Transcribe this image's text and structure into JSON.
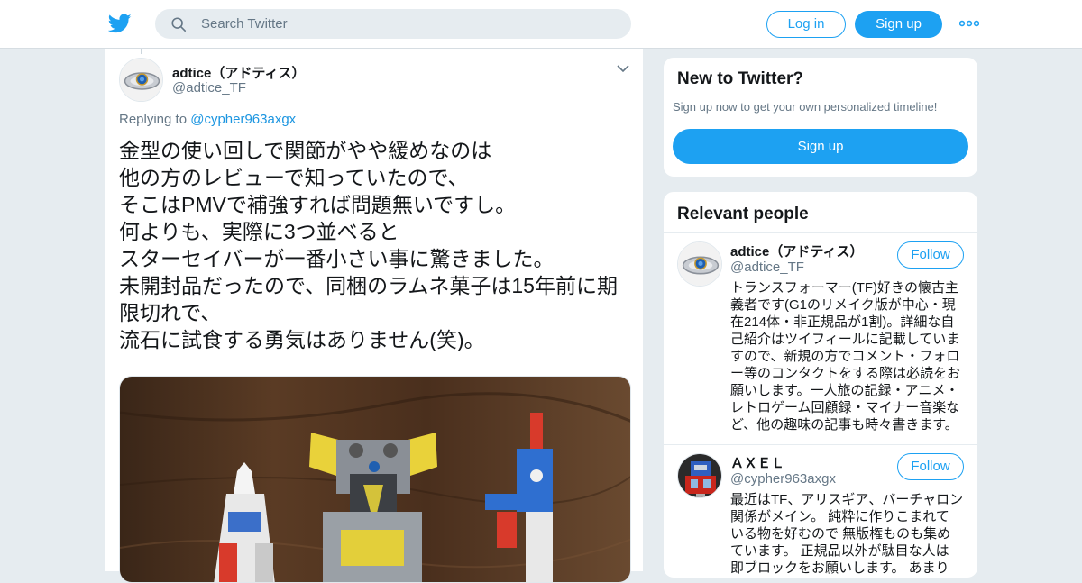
{
  "header": {
    "search_placeholder": "Search Twitter",
    "login_label": "Log in",
    "signup_label": "Sign up"
  },
  "tweet": {
    "author_name": "adtice（アドティス）",
    "author_handle": "@adtice_TF",
    "replying_prefix": "Replying to",
    "replying_to": "@cypher963axgx",
    "text_lines": [
      "金型の使い回しで関節がやや緩めなのは",
      "他の方のレビューで知っていたので、",
      "そこはPMVで補強すれば問題無いですし。",
      "何よりも、実際に3つ並べると",
      "スターセイバーが一番小さい事に驚きました。",
      "未開封品だったので、同梱のラムネ菓子は15年前に期",
      "限切れで、",
      "流石に試食する勇気はありません(笑)。"
    ]
  },
  "sidebar": {
    "new_to_twitter": {
      "title": "New to Twitter?",
      "subtitle": "Sign up now to get your own personalized timeline!",
      "button": "Sign up"
    },
    "relevant": {
      "title": "Relevant people",
      "people": [
        {
          "name": "adtice（アドティス）",
          "handle": "@adtice_TF",
          "follow": "Follow",
          "bio_lines": [
            "トランスフォーマー(TF)好きの懐古主",
            "義者です(G1のリメイク版が中心・現",
            "在214体・非正規品が1割)。詳細な自",
            "己紹介はツイフィールに記載していま",
            "すので、新規の方でコメント・フォロ",
            "ー等のコンタクトをする際は必読をお",
            "願いします。一人旅の記録・アニメ・",
            "レトロゲーム回顧録・マイナー音楽な",
            "ど、他の趣味の記事も時々書きます。"
          ]
        },
        {
          "name": "ＡＸＥＬ",
          "handle": "@cypher963axgx",
          "follow": "Follow",
          "bio_lines": [
            "最近はTF、アリスギア、バーチャロン",
            "関係がメイン。 純粋に作りこまれて",
            "いる物を好むので 無版権ものも集め",
            "ています。 正規品以外が駄目な人は",
            "即ブロックをお願いします。 あまり"
          ]
        }
      ]
    }
  },
  "colors": {
    "accent": "#1da1f2",
    "background": "#e6ecf0",
    "secondary_text": "#657786"
  }
}
